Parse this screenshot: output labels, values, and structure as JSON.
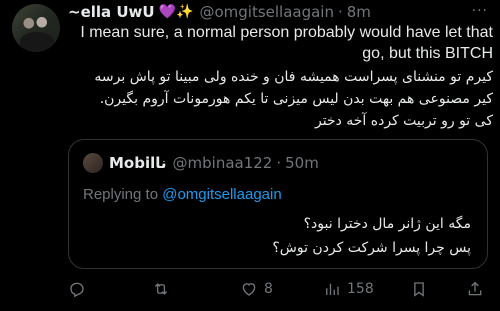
{
  "author": {
    "display_name": "~ella UwU",
    "emojis": "💜✨",
    "handle": "@omgitsellaagain",
    "time": "8m",
    "more": "···"
  },
  "body": {
    "english": "I mean sure, a normal person probably would have let that go, but this BITCH",
    "persian_lines": [
      "کیرم تو منشنای پسراست همیشه فان و خنده ولی مبینا تو پاش برسه",
      "کیر مصنوعی هم بهت بدن لیس میزنی تا یکم هورمونات آروم بگیرن.",
      "کی تو رو تربیت کرده آخه دختر"
    ]
  },
  "quote": {
    "display_name": "Mobiناا",
    "handle": "@mbinaa122",
    "time": "50m",
    "replying_prefix": "Replying to",
    "replying_handle": "@omgitsellaagain",
    "lines": [
      "مگه این ژانر مال دخترا نبود؟",
      "پس چرا پسرا شرکت کردن توش؟"
    ]
  },
  "actions": {
    "reply_count": "",
    "retweet_count": "",
    "like_count": "8",
    "views_count": "158"
  },
  "colors": {
    "background": "#000000",
    "text": "#e7e9ea",
    "muted": "#71767b",
    "link": "#1d9bf0",
    "border": "#2f3336"
  }
}
